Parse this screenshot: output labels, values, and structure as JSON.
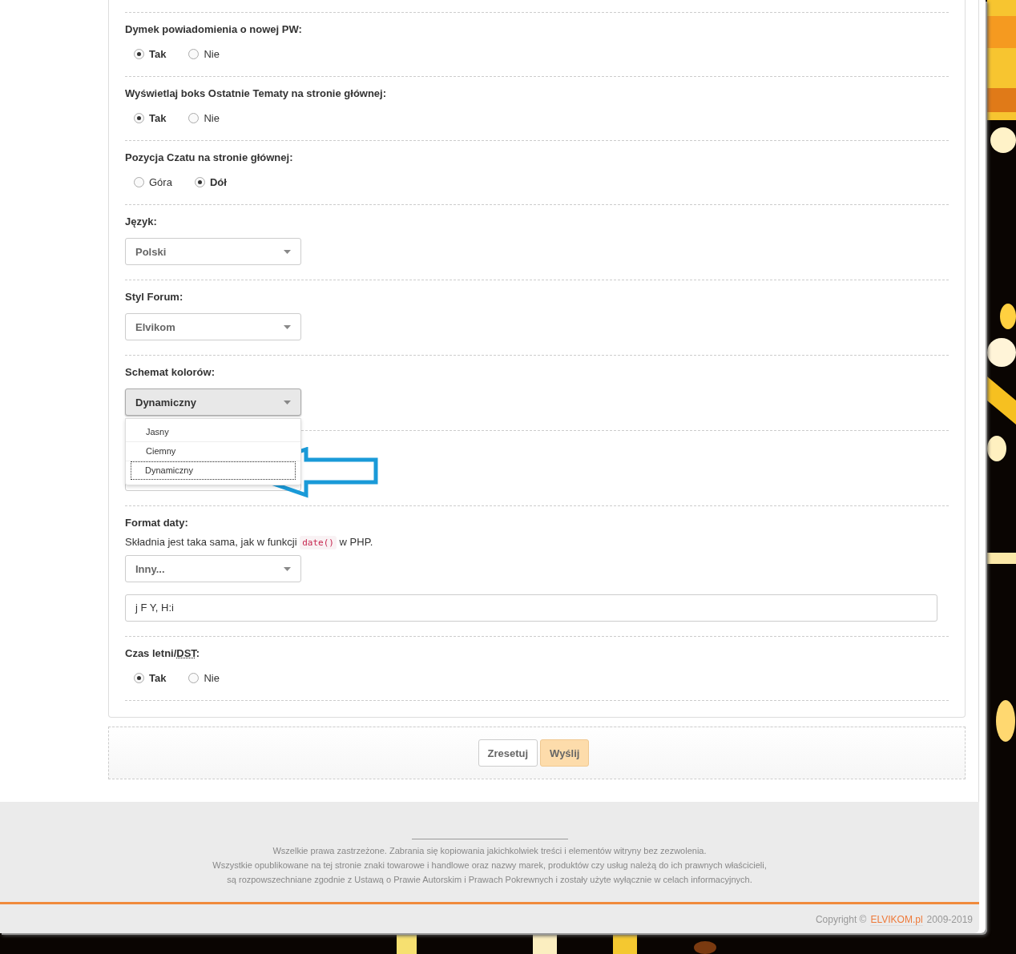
{
  "form": {
    "sections": [
      {
        "kind": "radio",
        "label": "Dymek powiadomienia o nowej PW:",
        "options": [
          {
            "label": "Tak",
            "selected": true
          },
          {
            "label": "Nie",
            "selected": false
          }
        ]
      },
      {
        "kind": "radio",
        "label": "Wyświetlaj boks Ostatnie Tematy na stronie głównej:",
        "options": [
          {
            "label": "Tak",
            "selected": true
          },
          {
            "label": "Nie",
            "selected": false
          }
        ]
      },
      {
        "kind": "radio",
        "label": "Pozycja Czatu na stronie głównej:",
        "options": [
          {
            "label": "Góra",
            "selected": false
          },
          {
            "label": "Dół",
            "selected": true
          }
        ]
      },
      {
        "kind": "select",
        "label": "Język:",
        "value": "Polski",
        "expanded": false
      },
      {
        "kind": "select",
        "label": "Styl Forum:",
        "value": "Elvikom",
        "expanded": false
      },
      {
        "kind": "select",
        "label": "Schemat kolorów:",
        "value": "Dynamiczny",
        "expanded": true,
        "options": [
          {
            "label": "Jasny",
            "selected": false
          },
          {
            "label": "Ciemny",
            "selected": false
          },
          {
            "label": "Dynamiczny",
            "selected": true
          }
        ]
      },
      {
        "kind": "date",
        "label": "Format daty:",
        "hint_before": "Składnia jest taka sama, jak w funkcji",
        "hint_code": "date()",
        "hint_after": "w PHP.",
        "value": "Inny...",
        "input": "j F Y, H:i"
      },
      {
        "kind": "radio",
        "label": "Czas letni/",
        "abbr": "DST",
        "label_end": ":",
        "options": [
          {
            "label": "Tak",
            "selected": true
          },
          {
            "label": "Nie",
            "selected": false
          }
        ]
      }
    ]
  },
  "buttons": [
    {
      "label": "Zresetuj",
      "kind": "reset"
    },
    {
      "label": "Wyślij",
      "kind": "submit"
    }
  ],
  "footer": {
    "lines": [
      "Wszelkie prawa zastrzeżone. Zabrania się kopiowania jakichkolwiek treści i elementów witryny bez zezwolenia.",
      "Wszystkie opublikowane na tej stronie znaki towarowe i handlowe oraz nazwy marek, produktów czy usług należą do ich prawnych właścicieli,",
      "są rozpowszechniane zgodnie z Ustawą o Prawie Autorskim i Prawach Pokrewnych i zostały użyte wyłącznie w celach informacyjnych."
    ],
    "copyright": {
      "prefix": "Copyright ©",
      "link": "ELVIKOM.pl",
      "suffix": "2009-2019"
    }
  }
}
